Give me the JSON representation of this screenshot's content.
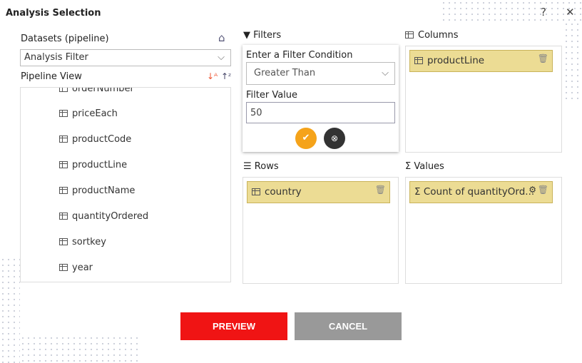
{
  "dialog": {
    "title": "Analysis Selection",
    "help": "?",
    "close": "✕"
  },
  "datasets": {
    "label": "Datasets (pipeline)",
    "selected": "Analysis Filter"
  },
  "pipeline": {
    "label": "Pipeline View",
    "items": [
      "orderNumber",
      "priceEach",
      "productCode",
      "productLine",
      "productName",
      "quantityOrdered",
      "sortkey",
      "year"
    ]
  },
  "filters": {
    "label": "Filters",
    "condition_label": "Enter a Filter Condition",
    "condition": "Greater Than",
    "value_label": "Filter Value",
    "value": "50"
  },
  "columns": {
    "label": "Columns",
    "items": [
      "productLine"
    ]
  },
  "rows": {
    "label": "Rows",
    "items": [
      "country"
    ]
  },
  "values": {
    "label": "Values",
    "items": [
      "Count of quantityOrd..."
    ]
  },
  "buttons": {
    "preview": "PREVIEW",
    "cancel": "CANCEL"
  },
  "colors": {
    "preview": "#f01414",
    "cancel": "#999999",
    "chip": "#ecdc94",
    "ok": "#f5a31a"
  }
}
